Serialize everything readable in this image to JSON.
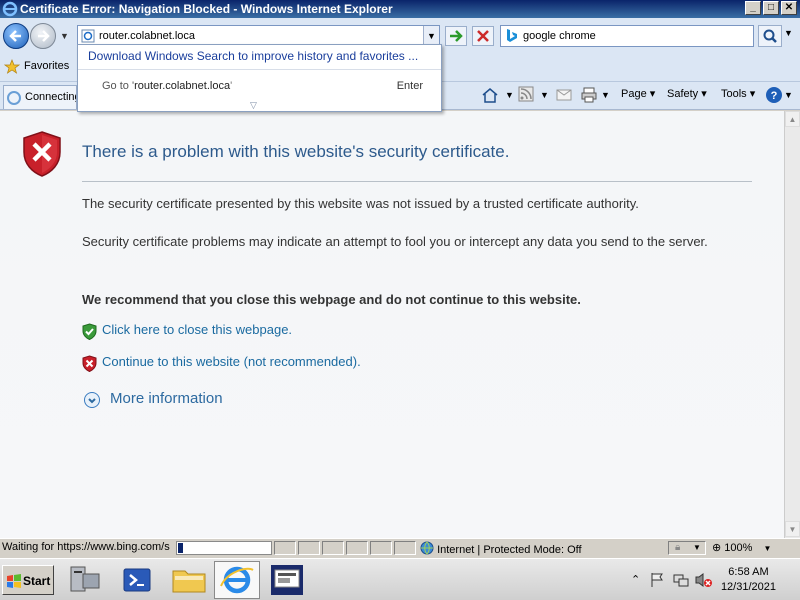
{
  "window": {
    "title": "Certificate Error: Navigation Blocked - Windows Internet Explorer",
    "controls": [
      "_",
      "□",
      "✕"
    ]
  },
  "address_bar": {
    "value": "router.colabnet.loca"
  },
  "search": {
    "value": "google chrome",
    "provider_icon": "bing-icon"
  },
  "autocomplete": {
    "promo": "Download Windows Search to improve history and favorites ...",
    "goto_prefix": "Go to '",
    "goto_value": "router.colabnet.loca",
    "goto_suffix": "'",
    "enter": "Enter"
  },
  "favorites": {
    "label": "Favorites"
  },
  "tab": {
    "label": "Connecting..."
  },
  "command_bar": {
    "page": "Page",
    "safety": "Safety",
    "tools": "Tools"
  },
  "content": {
    "heading": "There is a problem with this website's security certificate.",
    "para1": "The security certificate presented by this website was not issued by a trusted certificate authority.",
    "para2": "Security certificate problems may indicate an attempt to fool you or intercept any data you send to the server.",
    "recommend": "We recommend that you close this webpage and do not continue to this website.",
    "close_link": "Click here to close this webpage.",
    "continue_link": "Continue to this website (not recommended).",
    "more_info": "More information"
  },
  "status_bar": {
    "text": "Waiting for https://www.bing.com/s",
    "zone": "Internet | Protected Mode: Off",
    "zoom": "100%"
  },
  "taskbar": {
    "start": "Start",
    "time": "6:58 AM",
    "date": "12/31/2021"
  },
  "colors": {
    "heading": "#2d5a8c",
    "link": "#1a6aa0",
    "titlebar": "#0a246a"
  }
}
